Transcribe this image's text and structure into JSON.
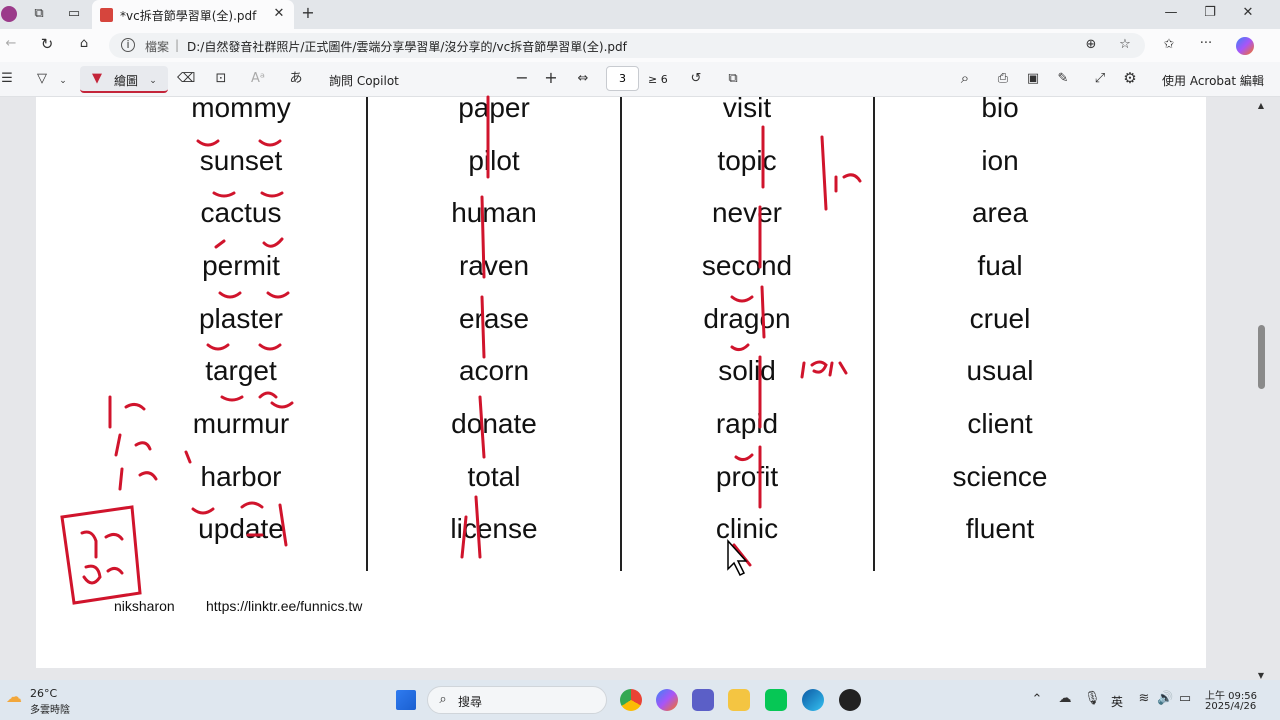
{
  "browser": {
    "tab_title": "*vc拆音節學習單(全).pdf",
    "url_source_label": "檔案",
    "url": "D:/自然發音社群照片/正式圖件/雲端分享學習單/沒分享的/vc拆音節學習單(全).pdf"
  },
  "pdf_toolbar": {
    "draw_label": "繪圖",
    "copilot_label": "詢問 Copilot",
    "page_number": "3",
    "page_total": "≥ 6",
    "acrobat_label": "使用 Acrobat 編輯"
  },
  "document": {
    "columns": [
      [
        "mommy",
        "sunset",
        "cactus",
        "permit",
        "plaster",
        "target",
        "murmur",
        "harbor",
        "update"
      ],
      [
        "paper",
        "pilot",
        "human",
        "raven",
        "erase",
        "acorn",
        "donate",
        "total",
        "license"
      ],
      [
        "visit",
        "topic",
        "never",
        "second",
        "dragon",
        "solid",
        "rapid",
        "profit",
        "clinic"
      ],
      [
        "bio",
        "ion",
        "area",
        "fual",
        "cruel",
        "usual",
        "client",
        "science",
        "fluent"
      ]
    ],
    "footer_name": "niksharon",
    "footer_link": "https://linktr.ee/funnics.tw"
  },
  "taskbar": {
    "weather_temp": "26°C",
    "weather_desc": "多雲時陰",
    "search_placeholder": "搜尋",
    "ime": "英",
    "time": "上午 09:56",
    "date": "2025/4/26"
  },
  "colors": {
    "ink": "#d0142c",
    "accent": "#c4253a"
  }
}
